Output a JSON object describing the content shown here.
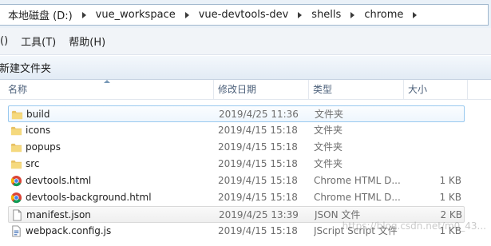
{
  "address_bar": {
    "crumbs": [
      "本地磁盘 (D:)",
      "vue_workspace",
      "vue-devtools-dev",
      "shells",
      "chrome"
    ]
  },
  "menu": {
    "view_partial": "()",
    "tools": "工具(T)",
    "help": "帮助(H)"
  },
  "command_bar": {
    "new_folder": "新建文件夹"
  },
  "columns": {
    "name": "名称",
    "date": "修改日期",
    "type": "类型",
    "size": "大小"
  },
  "files": [
    {
      "name": "build",
      "date": "2019/4/25 11:36",
      "type": "文件夹",
      "size": "",
      "icon": "folder-icon",
      "state": "selected"
    },
    {
      "name": "icons",
      "date": "2019/4/15 15:18",
      "type": "文件夹",
      "size": "",
      "icon": "folder-icon",
      "state": ""
    },
    {
      "name": "popups",
      "date": "2019/4/15 15:18",
      "type": "文件夹",
      "size": "",
      "icon": "folder-icon",
      "state": ""
    },
    {
      "name": "src",
      "date": "2019/4/15 15:18",
      "type": "文件夹",
      "size": "",
      "icon": "folder-icon",
      "state": ""
    },
    {
      "name": "devtools.html",
      "date": "2019/4/15 15:18",
      "type": "Chrome HTML D...",
      "size": "1 KB",
      "icon": "chrome-icon",
      "state": ""
    },
    {
      "name": "devtools-background.html",
      "date": "2019/4/15 15:18",
      "type": "Chrome HTML D...",
      "size": "1 KB",
      "icon": "chrome-icon",
      "state": ""
    },
    {
      "name": "manifest.json",
      "date": "2019/4/25 13:39",
      "type": "JSON 文件",
      "size": "2 KB",
      "icon": "document-icon",
      "state": "hover"
    },
    {
      "name": "webpack.config.js",
      "date": "2019/4/15 15:18",
      "type": "JScript Script 文件",
      "size": "1 KB",
      "icon": "script-icon",
      "state": ""
    }
  ],
  "watermark": "https://blog.csdn.net/m0_43..."
}
